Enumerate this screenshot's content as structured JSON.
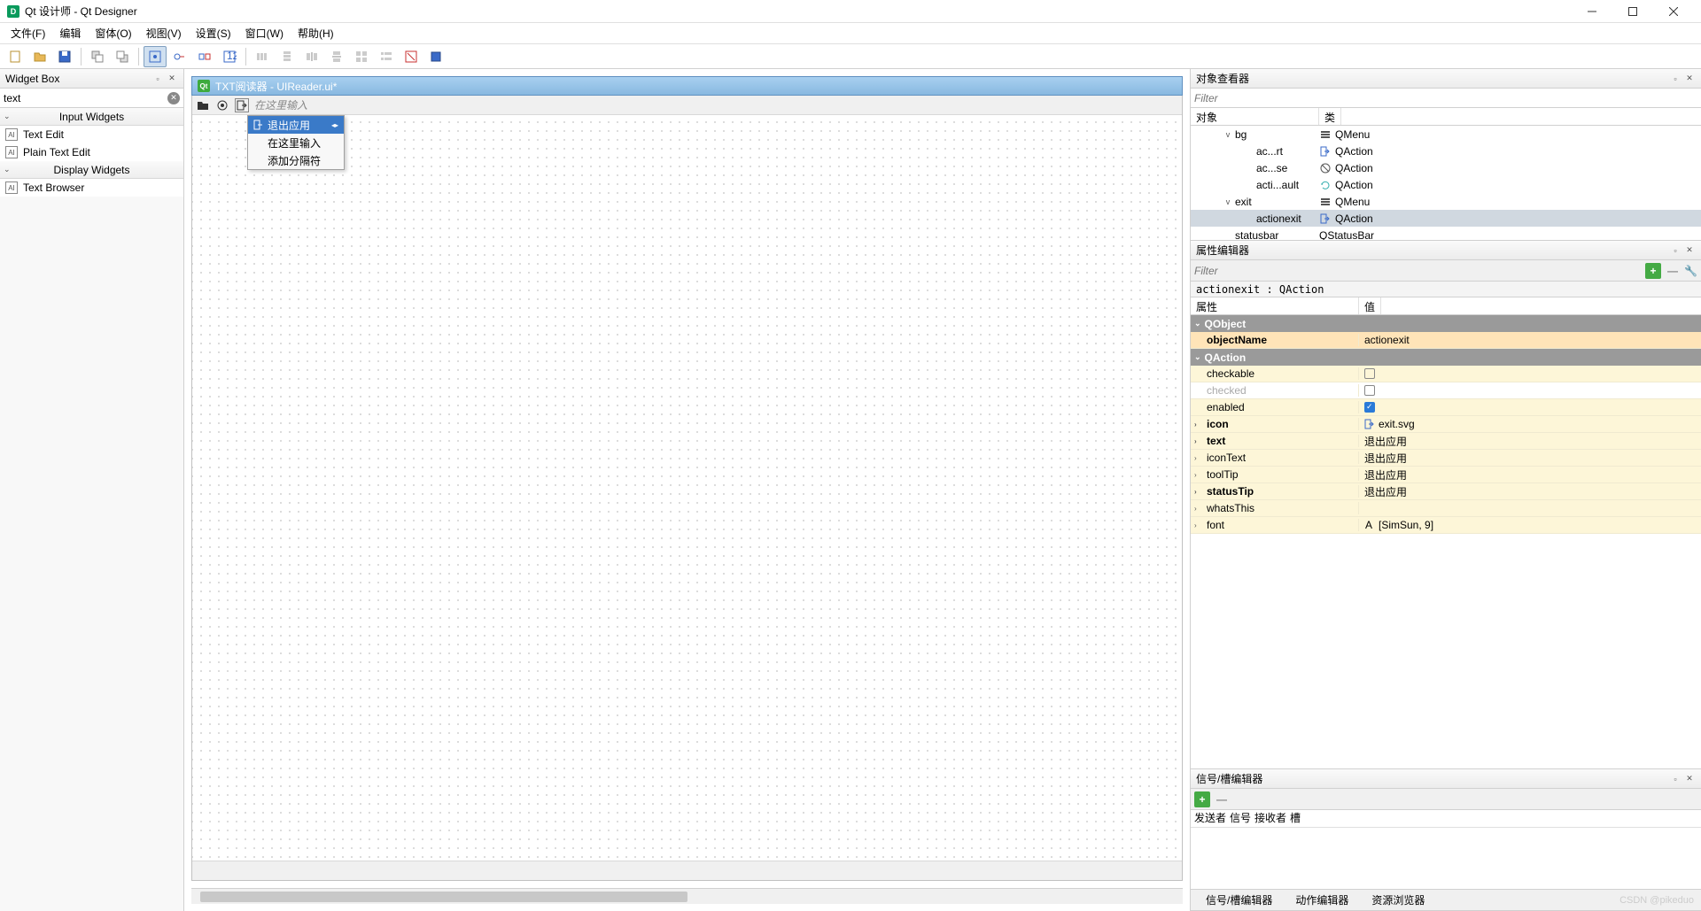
{
  "window": {
    "title": "Qt 设计师 - Qt Designer"
  },
  "menubar": [
    "文件(F)",
    "编辑",
    "窗体(O)",
    "视图(V)",
    "设置(S)",
    "窗口(W)",
    "帮助(H)"
  ],
  "widgetbox": {
    "title": "Widget Box",
    "search": "text",
    "cats": [
      {
        "name": "Input Widgets",
        "items": [
          "Text Edit",
          "Plain Text Edit"
        ]
      },
      {
        "name": "Display Widgets",
        "items": [
          "Text Browser"
        ]
      }
    ]
  },
  "form": {
    "title": "TXT阅读器 - UIReader.ui*",
    "menu_placeholder": "在这里输入",
    "context": [
      "退出应用",
      "在这里输入",
      "添加分隔符"
    ]
  },
  "object_inspector": {
    "title": "对象查看器",
    "filter_placeholder": "Filter",
    "headers": [
      "对象",
      "类"
    ],
    "rows": [
      {
        "indent": 3,
        "toggle": "v",
        "name": "bg",
        "cls": "QMenu",
        "icon": "menu"
      },
      {
        "indent": 5,
        "toggle": "",
        "name": "ac...rt",
        "cls": "QAction",
        "icon": "exit"
      },
      {
        "indent": 5,
        "toggle": "",
        "name": "ac...se",
        "cls": "QAction",
        "icon": "block"
      },
      {
        "indent": 5,
        "toggle": "",
        "name": "acti...ault",
        "cls": "QAction",
        "icon": "refresh"
      },
      {
        "indent": 3,
        "toggle": "v",
        "name": "exit",
        "cls": "QMenu",
        "icon": "menu"
      },
      {
        "indent": 5,
        "toggle": "",
        "name": "actionexit",
        "cls": "QAction",
        "icon": "exit",
        "sel": true
      },
      {
        "indent": 3,
        "toggle": "",
        "name": "statusbar",
        "cls": "QStatusBar",
        "icon": ""
      }
    ]
  },
  "property_editor": {
    "title": "属性编辑器",
    "filter_placeholder": "Filter",
    "class_line": "actionexit : QAction",
    "headers": [
      "属性",
      "值"
    ],
    "groups": [
      {
        "name": "QObject",
        "rows": [
          {
            "name": "objectName",
            "value": "actionexit",
            "style": "orange",
            "bold": true
          }
        ]
      },
      {
        "name": "QAction",
        "rows": [
          {
            "name": "checkable",
            "value": "",
            "check": false,
            "style": "yellow"
          },
          {
            "name": "checked",
            "value": "",
            "check": false,
            "style": "white",
            "disabled": true
          },
          {
            "name": "enabled",
            "value": "",
            "check": true,
            "style": "yellow"
          },
          {
            "name": "icon",
            "value": "exit.svg",
            "style": "yellow",
            "bold": true,
            "expand": true,
            "icon": "exit"
          },
          {
            "name": "text",
            "value": "退出应用",
            "style": "yellow",
            "bold": true,
            "expand": true
          },
          {
            "name": "iconText",
            "value": "退出应用",
            "style": "yellow",
            "expand": true
          },
          {
            "name": "toolTip",
            "value": "退出应用",
            "style": "yellow",
            "expand": true
          },
          {
            "name": "statusTip",
            "value": "退出应用",
            "style": "yellow",
            "bold": true,
            "expand": true
          },
          {
            "name": "whatsThis",
            "value": "",
            "style": "yellow",
            "expand": true
          },
          {
            "name": "font",
            "value": "[SimSun, 9]",
            "style": "yellow",
            "expand": true,
            "icon": "font"
          }
        ]
      }
    ]
  },
  "signal_editor": {
    "title": "信号/槽编辑器",
    "headers": [
      "发送者",
      "信号",
      "接收者",
      "槽"
    ]
  },
  "bottom_tabs": [
    "信号/槽编辑器",
    "动作编辑器",
    "资源浏览器"
  ],
  "watermark": "CSDN @pikeduo"
}
